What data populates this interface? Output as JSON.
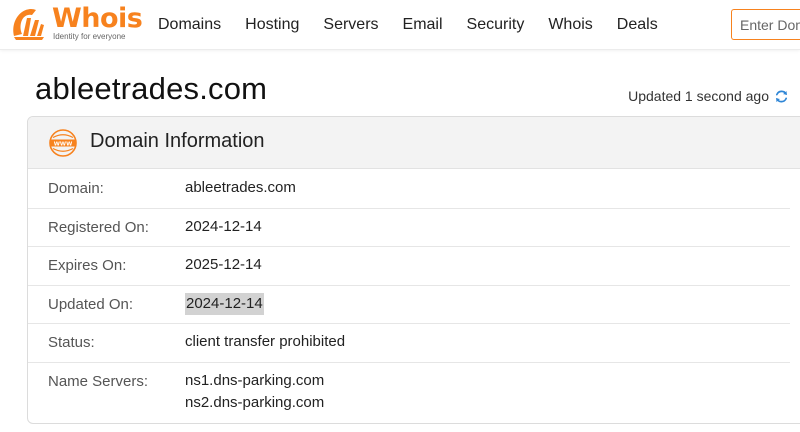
{
  "brand": {
    "name": "Whois",
    "tagline": "Identity for everyone",
    "accent_color": "#f7821e"
  },
  "nav": {
    "items": [
      "Domains",
      "Hosting",
      "Servers",
      "Email",
      "Security",
      "Whois",
      "Deals"
    ]
  },
  "search": {
    "placeholder": "Enter Domain",
    "value": ""
  },
  "page": {
    "domain": "ableetrades.com",
    "updated_text": "Updated 1 second ago",
    "refresh_icon": "refresh-icon"
  },
  "card": {
    "icon": "www-icon",
    "title": "Domain Information",
    "rows": [
      {
        "label": "Domain:",
        "value": "ableetrades.com"
      },
      {
        "label": "Registered On:",
        "value": "2024-12-14"
      },
      {
        "label": "Expires On:",
        "value": "2025-12-14"
      },
      {
        "label": "Updated On:",
        "value": "2024-12-14"
      },
      {
        "label": "Status:",
        "value": "client transfer prohibited"
      }
    ],
    "name_servers": {
      "label": "Name Servers:",
      "values": [
        "ns1.dns-parking.com",
        "ns2.dns-parking.com"
      ]
    }
  }
}
